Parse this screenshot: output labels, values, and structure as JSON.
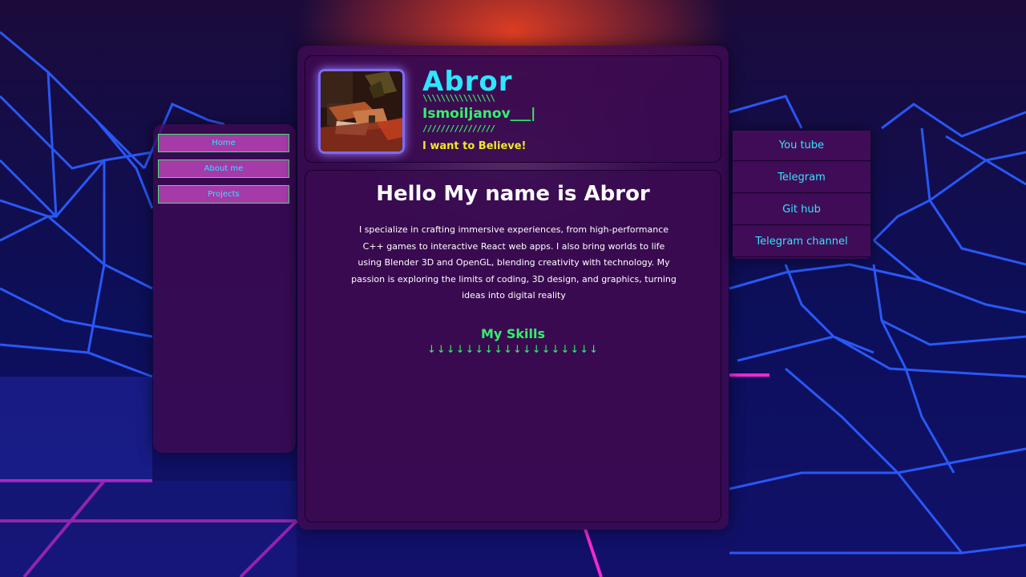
{
  "nav": {
    "items": [
      {
        "label": "Home"
      },
      {
        "label": "About me"
      },
      {
        "label": "Projects"
      }
    ]
  },
  "profile": {
    "name": "Abror",
    "deco_top": "\\\\\\\\\\\\\\\\\\\\\\\\\\\\\\\\",
    "surname": "Ismoiljanov___|",
    "deco_bottom": "////////////////",
    "motto": "I want to Believe!"
  },
  "about": {
    "heading": "Hello My name is Abror",
    "bio": "I specialize in crafting immersive experiences, from high-performance C++ games to interactive React web apps. I also bring worlds to life using Blender 3D and OpenGL, blending creativity with technology. My passion is exploring the limits of coding, 3D design, and graphics, turning ideas into digital reality",
    "skills_title": "My Skills",
    "skills_arrows": "↓↓↓↓↓↓↓↓↓↓↓↓↓↓↓↓↓↓"
  },
  "links": {
    "items": [
      {
        "label": "You tube"
      },
      {
        "label": "Telegram"
      },
      {
        "label": "Git hub"
      },
      {
        "label": "Telegram channel"
      }
    ]
  },
  "colors": {
    "accent_cyan": "#2ee6ff",
    "accent_green": "#33f06a",
    "accent_yellow": "#f0e827",
    "nav_button": "#a53aa8",
    "panel": "#400a52"
  }
}
